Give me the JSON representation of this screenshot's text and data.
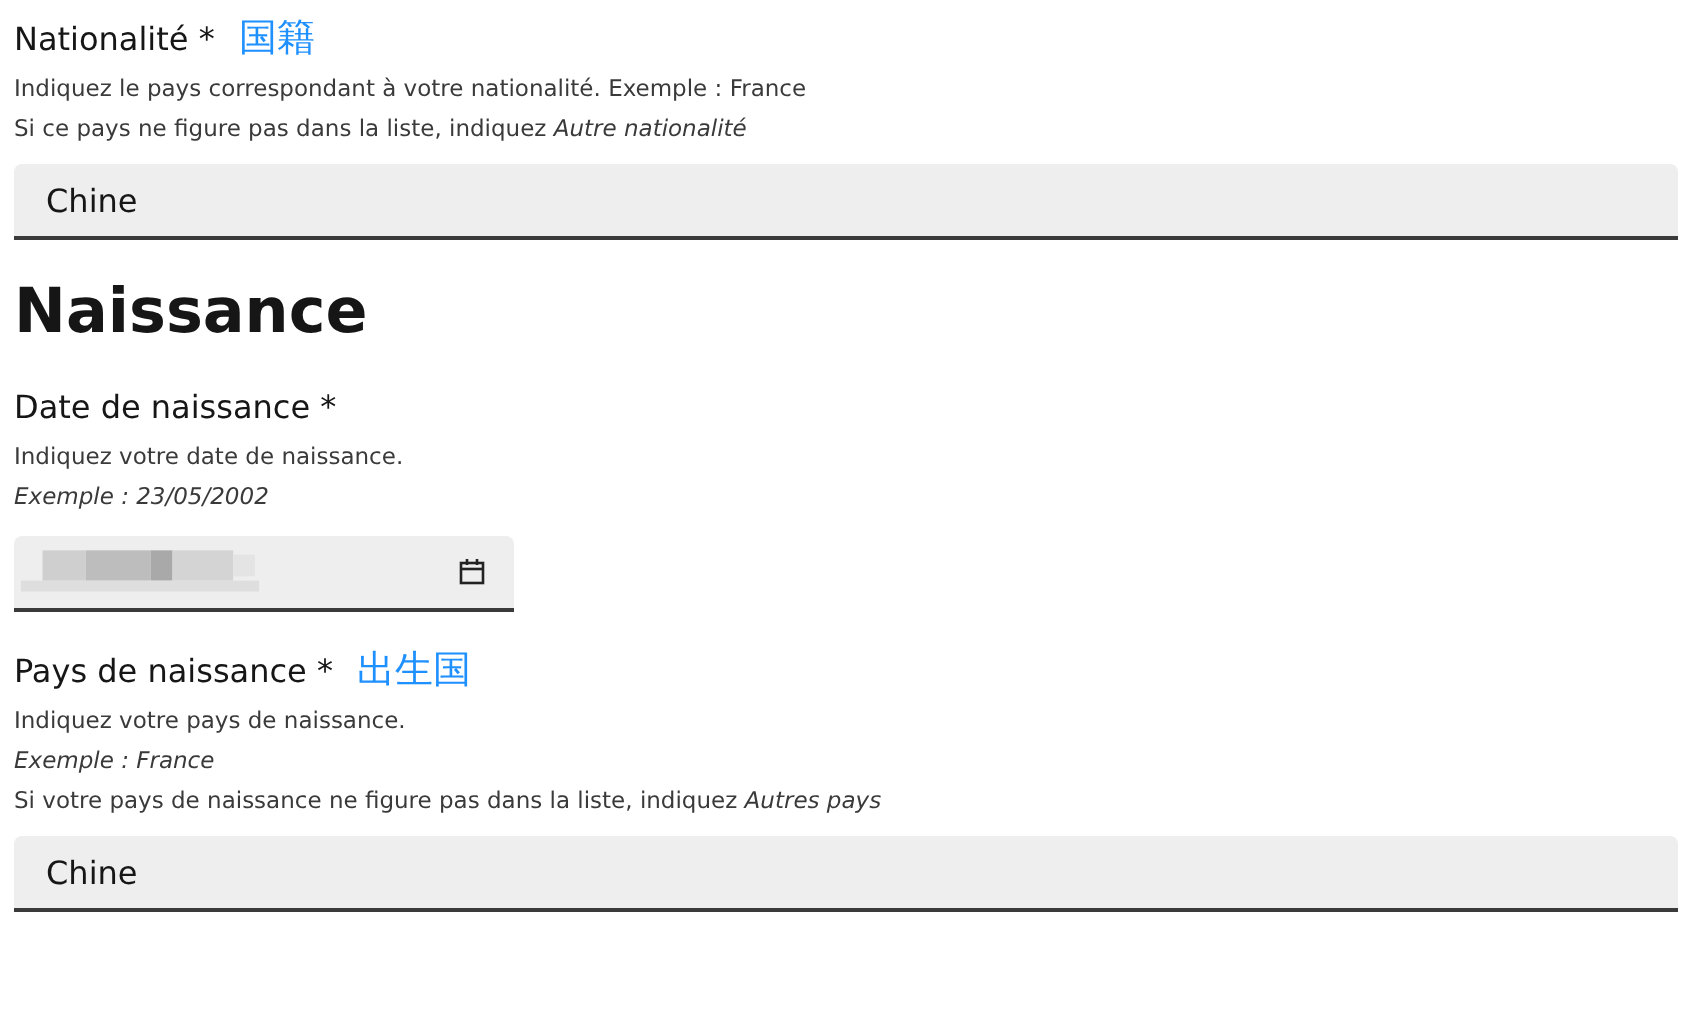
{
  "fields": [
    {
      "kind": "select",
      "label": "Nationalité *",
      "annotation": "国籍",
      "hints": [
        "Indiquez le pays correspondant à votre nationalité. Exemple : France",
        "Si ce pays ne figure pas dans la liste, indiquez *Autre nationalité*"
      ],
      "value": "Chine"
    },
    {
      "kind": "heading",
      "text": "Naissance"
    },
    {
      "kind": "date",
      "label": "Date de naissance *",
      "hints": [
        "Indiquez votre date de naissance.",
        "*Exemple : 23/05/2002*"
      ],
      "redacted": true
    },
    {
      "kind": "select",
      "label": "Pays de naissance *",
      "annotation": "出生国",
      "hints": [
        "Indiquez votre pays de naissance.",
        "*Exemple : France*",
        "Si votre pays de naissance ne figure pas dans la liste, indiquez *Autres pays*"
      ],
      "value": "Chine"
    }
  ]
}
